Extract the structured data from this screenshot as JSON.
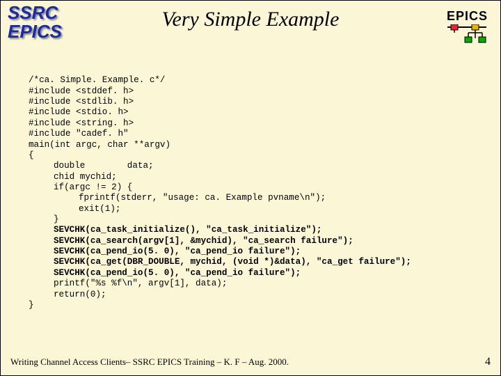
{
  "logo": {
    "line1": "SSRC",
    "line2": "EPICS"
  },
  "title": "Very Simple Example",
  "epics_label": "EPICS",
  "code": {
    "l01": "/*ca. Simple. Example. c*/",
    "l02": "#include <stddef. h>",
    "l03": "#include <stdlib. h>",
    "l04": "#include <stdio. h>",
    "l05": "#include <string. h>",
    "l06": "#include \"cadef. h\"",
    "l07": "main(int argc, char **argv)",
    "l08": "{",
    "l09": "double        data;",
    "l10": "chid mychid;",
    "l11": "if(argc != 2) {",
    "l12": "fprintf(stderr, \"usage: ca. Example pvname\\n\");",
    "l13": "exit(1);",
    "l14": "}",
    "l15": "SEVCHK(ca_task_initialize(), \"ca_task_initialize\");",
    "l16": "SEVCHK(ca_search(argv[1], &mychid), \"ca_search failure\");",
    "l17": "SEVCHK(ca_pend_io(5. 0), \"ca_pend_io failure\");",
    "l18": "SEVCHK(ca_get(DBR_DOUBLE, mychid, (void *)&data), \"ca_get failure\");",
    "l19": "SEVCHK(ca_pend_io(5. 0), \"ca_pend_io failure\");",
    "l20": "printf(\"%s %f\\n\", argv[1], data);",
    "l21": "return(0);",
    "l22": "}"
  },
  "footer": {
    "text": "Writing Channel Access Clients– SSRC EPICS Training – K. F – Aug. 2000.",
    "page": "4"
  }
}
